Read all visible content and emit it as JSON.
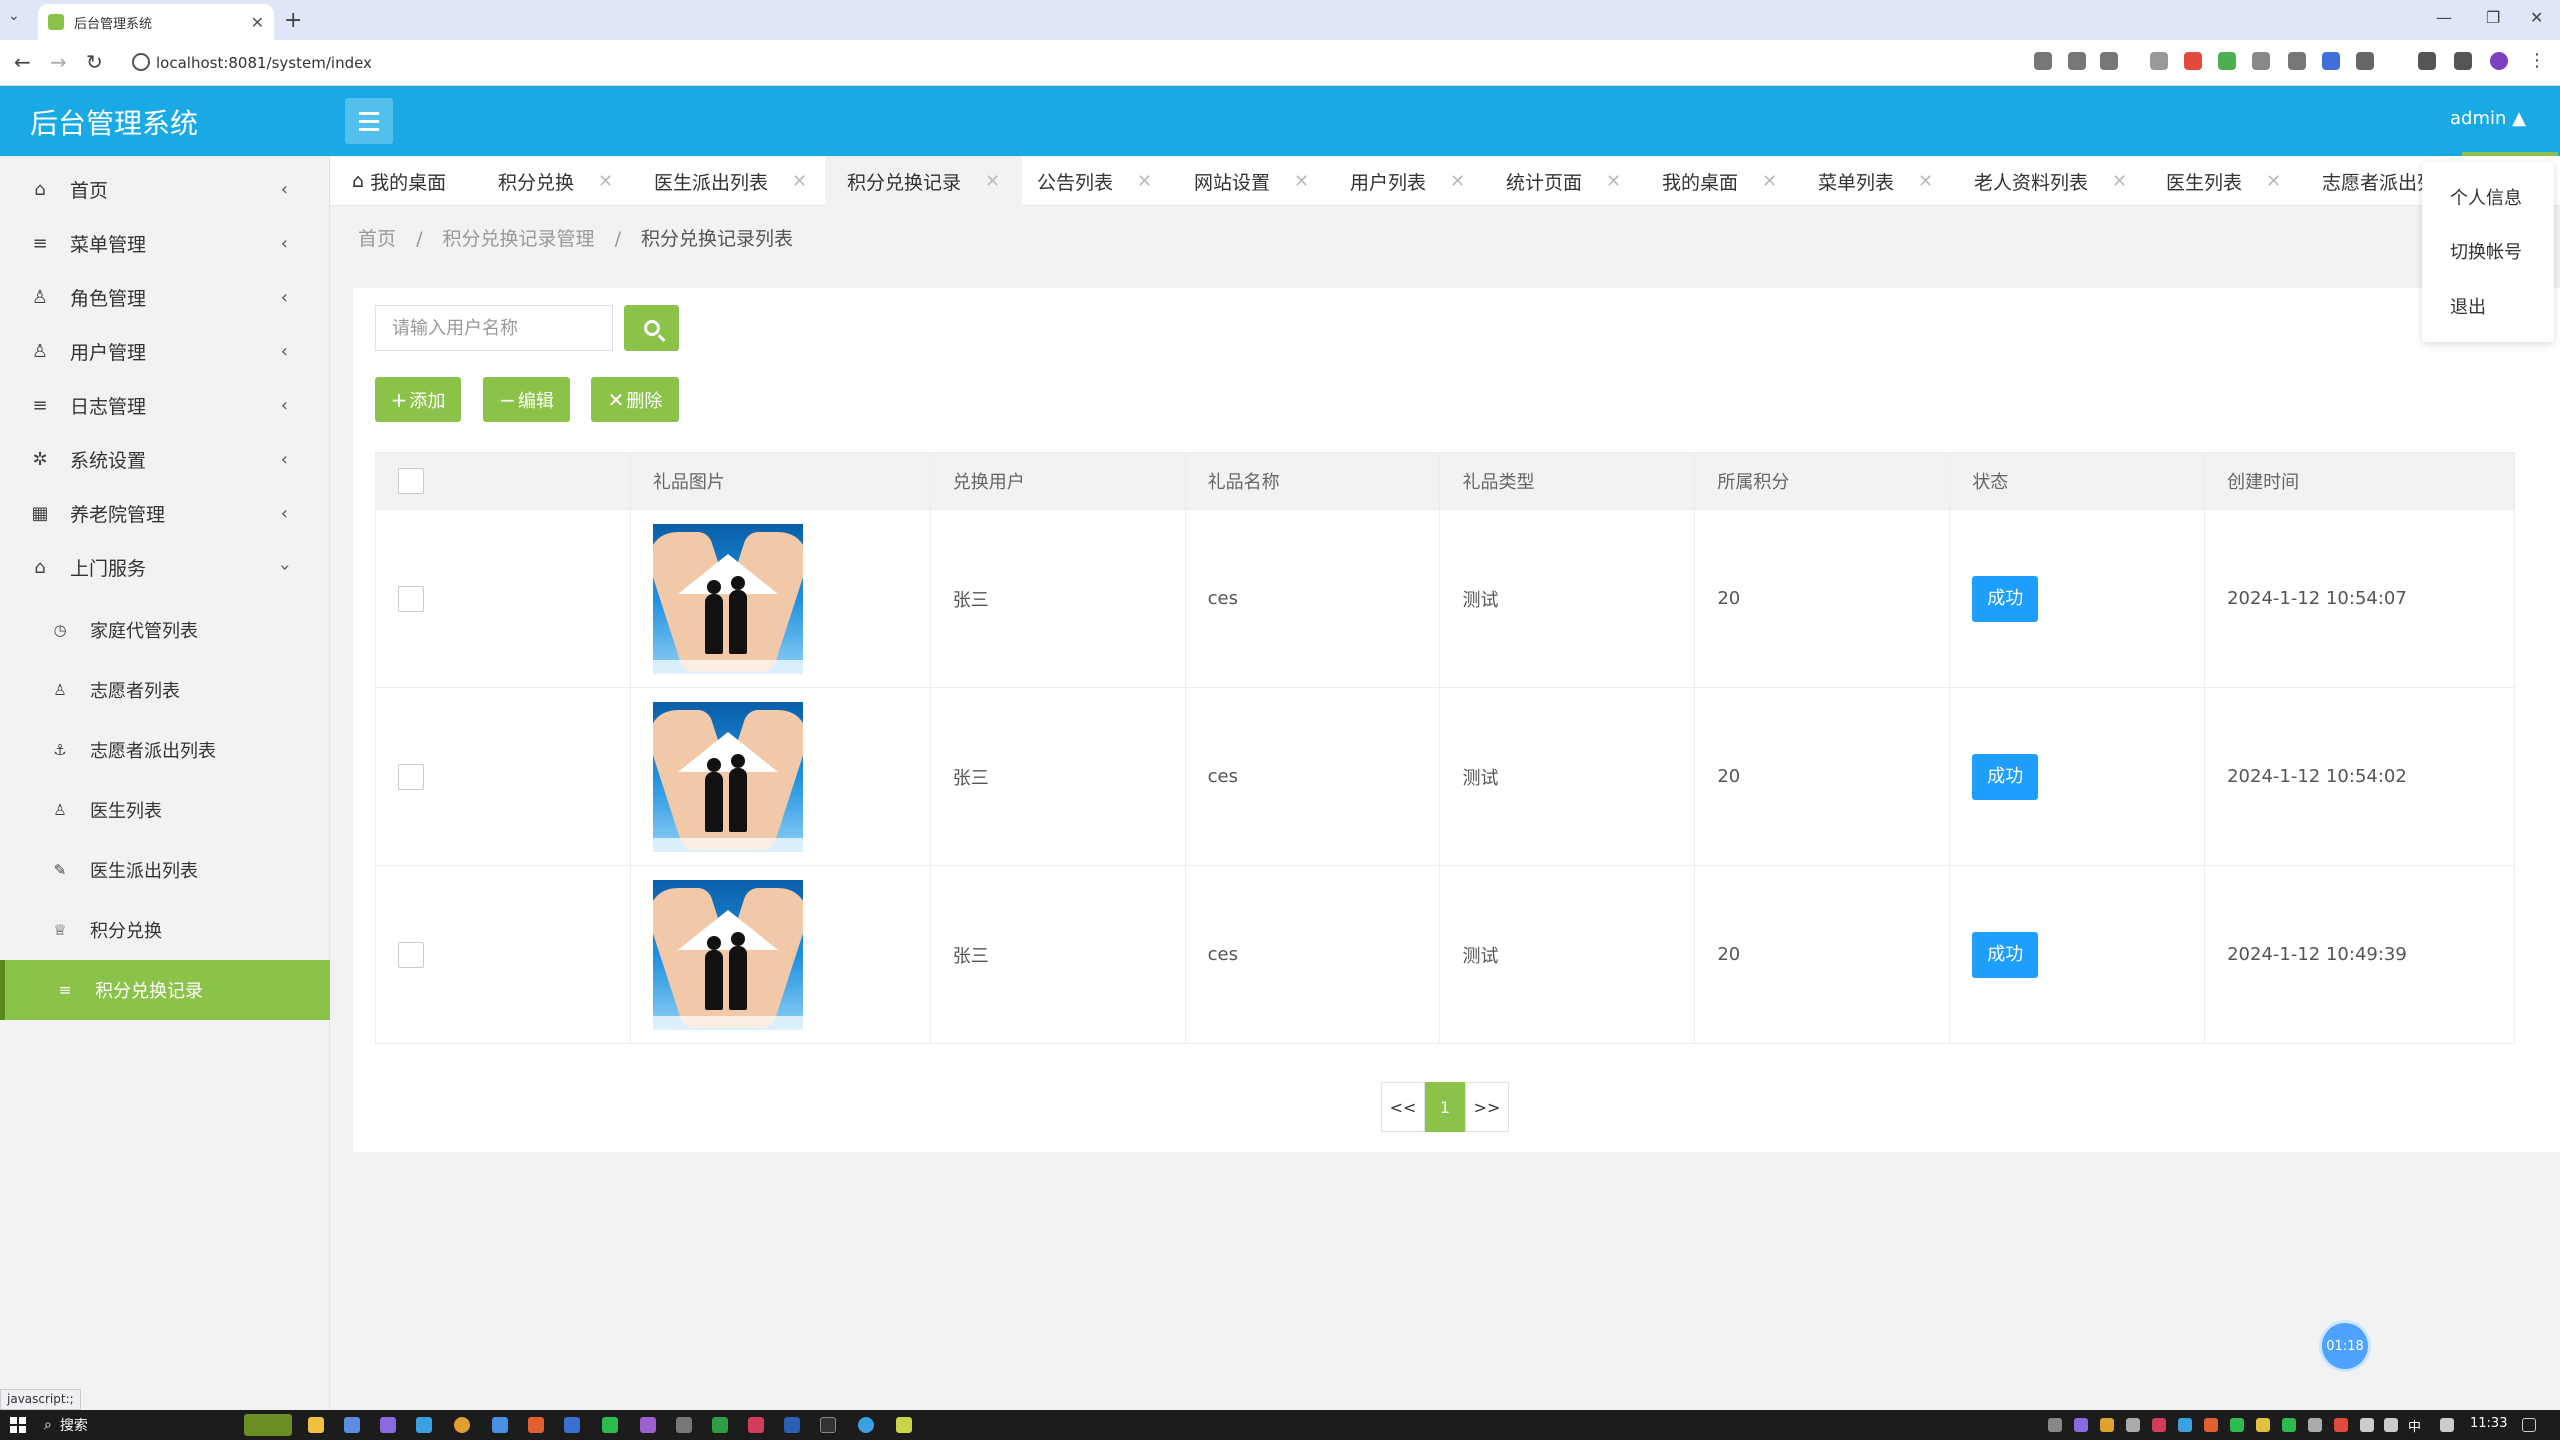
{
  "browser": {
    "tab_title": "后台管理系统",
    "url": "localhost:8081/system/index"
  },
  "header": {
    "app_title": "后台管理系统",
    "user": "admin ▲"
  },
  "sidebar": {
    "items": [
      {
        "label": "首页",
        "icon": "home-icon"
      },
      {
        "label": "菜单管理",
        "icon": "list-icon"
      },
      {
        "label": "角色管理",
        "icon": "user-icon"
      },
      {
        "label": "用户管理",
        "icon": "user-icon"
      },
      {
        "label": "日志管理",
        "icon": "list-icon"
      },
      {
        "label": "系统设置",
        "icon": "gear-icon"
      },
      {
        "label": "养老院管理",
        "icon": "grid-icon"
      },
      {
        "label": "上门服务",
        "icon": "house-icon"
      }
    ],
    "sub_items": [
      {
        "label": "家庭代管列表",
        "icon": "clock-icon"
      },
      {
        "label": "志愿者列表",
        "icon": "user-icon"
      },
      {
        "label": "志愿者派出列表",
        "icon": "anchor-icon"
      },
      {
        "label": "医生列表",
        "icon": "user-icon"
      },
      {
        "label": "医生派出列表",
        "icon": "edit-icon"
      },
      {
        "label": "积分兑换",
        "icon": "gift-icon"
      },
      {
        "label": "积分兑换记录",
        "icon": "list-icon"
      }
    ]
  },
  "tabs": [
    {
      "label": "我的桌面"
    },
    {
      "label": "积分兑换"
    },
    {
      "label": "医生派出列表"
    },
    {
      "label": "积分兑换记录"
    },
    {
      "label": "公告列表"
    },
    {
      "label": "网站设置"
    },
    {
      "label": "用户列表"
    },
    {
      "label": "统计页面"
    },
    {
      "label": "我的桌面"
    },
    {
      "label": "菜单列表"
    },
    {
      "label": "老人资料列表"
    },
    {
      "label": "医生列表"
    },
    {
      "label": "志愿者派出列"
    }
  ],
  "breadcrumb": {
    "home": "首页",
    "sep": "/",
    "section": "积分兑换记录管理",
    "current": "积分兑换记录列表"
  },
  "dropdown": {
    "items": [
      "个人信息",
      "切换帐号",
      "退出"
    ]
  },
  "search": {
    "placeholder": "请输入用户名称"
  },
  "actions": {
    "add": "添加",
    "edit": "编辑",
    "delete": "删除"
  },
  "table": {
    "headers": [
      "礼品图片",
      "兑换用户",
      "礼品名称",
      "礼品类型",
      "所属积分",
      "状态",
      "创建时间"
    ],
    "rows": [
      {
        "user": "张三",
        "gift_name": "ces",
        "gift_type": "测试",
        "points": "20",
        "status": "成功",
        "created": "2024-1-12 10:54:07"
      },
      {
        "user": "张三",
        "gift_name": "ces",
        "gift_type": "测试",
        "points": "20",
        "status": "成功",
        "created": "2024-1-12 10:54:02"
      },
      {
        "user": "张三",
        "gift_name": "ces",
        "gift_type": "测试",
        "points": "20",
        "status": "成功",
        "created": "2024-1-12 10:49:39"
      }
    ]
  },
  "pagination": {
    "prev": "<<",
    "current": "1",
    "next": ">>"
  },
  "timer": "01:18",
  "status_url": "javascript:;",
  "taskbar": {
    "search": "搜索",
    "ime": "中",
    "time": "11:33"
  },
  "colors": {
    "header": "#19aae6",
    "accent_green": "#8bc34a",
    "status_blue": "#1e9fff"
  }
}
